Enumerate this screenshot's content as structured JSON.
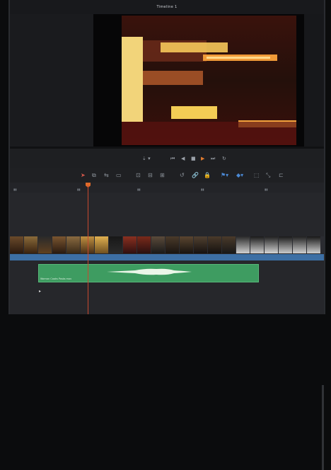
{
  "header": {
    "timeline_name": "Timeline 1"
  },
  "colors": {
    "accent": "#e07a2e",
    "video_track": "#3d6fa4",
    "audio_clip": "#3e9c61",
    "playhead": "#c8492f"
  },
  "transport": {
    "buttons": [
      "first-frame-icon",
      "step-back-icon",
      "stop-icon",
      "play-icon",
      "last-frame-icon",
      "loop-icon"
    ]
  },
  "toolbar": {
    "tools": [
      "selection-icon",
      "trim-icon",
      "blade-icon",
      "insert-icon",
      "overwrite-icon",
      "replace-icon",
      "snapping-icon",
      "linked-icon",
      "flag-icon",
      "marker-icon",
      "zoom-icon"
    ]
  },
  "audio": {
    "clip_label": "Woman Cooks Pasta.mov"
  }
}
